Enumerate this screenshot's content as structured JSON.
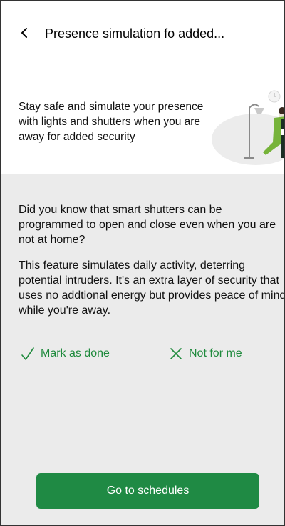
{
  "header": {
    "title": "Presence simulation fo added...",
    "back_icon": "chevron-left-icon"
  },
  "intro": {
    "text": "Stay safe and simulate your presence with lights and shutters when you are away for added security",
    "illustration": "person-with-floor-lamp-illustration"
  },
  "content": {
    "paragraph_1": "Did you know that smart shutters can be programmed to open and close even when you are not at home?",
    "paragraph_2": "This feature simulates daily activity, deterring potential intruders. It's an extra layer of security that uses no addtional energy but provides peace of mind while you're away."
  },
  "actions": {
    "done_label": "Mark as done",
    "done_icon": "checkmark-icon",
    "dismiss_label": "Not for me",
    "dismiss_icon": "close-icon"
  },
  "cta": {
    "label": "Go to schedules"
  },
  "colors": {
    "accent_green": "#1e8a3c",
    "button_green": "#1f8a44",
    "content_background": "#ebebeb"
  }
}
